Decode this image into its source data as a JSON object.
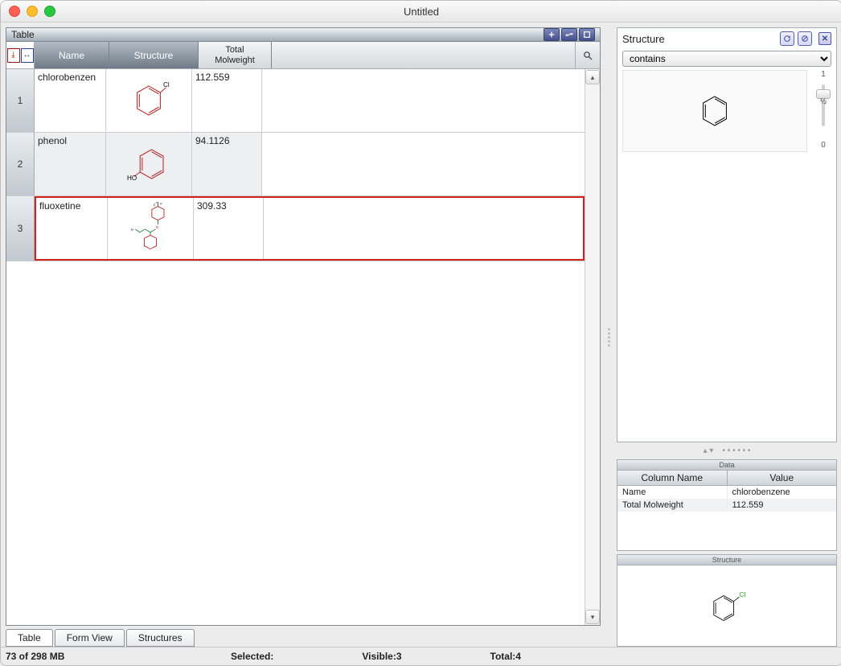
{
  "window": {
    "title": "Untitled"
  },
  "main_panel": {
    "title": "Table"
  },
  "columns": {
    "name": "Name",
    "structure": "Structure",
    "molweight": "Total\nMolweight"
  },
  "rows": [
    {
      "idx": "1",
      "name": "chlorobenzen",
      "mw": "112.559",
      "struct_label": "Cl"
    },
    {
      "idx": "2",
      "name": "phenol",
      "mw": "94.1126",
      "struct_label": "HO"
    },
    {
      "idx": "3",
      "name": "fluoxetine",
      "mw": "309.33",
      "struct_label": ""
    }
  ],
  "structure_panel": {
    "title": "Structure",
    "dropdown": "contains",
    "slider": {
      "top": "1",
      "mid": "½",
      "bot": "0"
    }
  },
  "data_panel": {
    "title": "Data",
    "headers": {
      "col": "Column Name",
      "val": "Value"
    },
    "rows": [
      {
        "col": "Name",
        "val": "chlorobenzene"
      },
      {
        "col": "Total Molweight",
        "val": "112.559"
      }
    ]
  },
  "detail_panel": {
    "title": "Structure",
    "label": "Cl"
  },
  "view_tabs": {
    "table": "Table",
    "form": "Form View",
    "struct": "Structures"
  },
  "status": {
    "mem": "73 of 298 MB",
    "selected_lbl": "Selected:",
    "visible_lbl": "Visible:",
    "visible_val": "3",
    "total_lbl": "Total:",
    "total_val": "4"
  }
}
